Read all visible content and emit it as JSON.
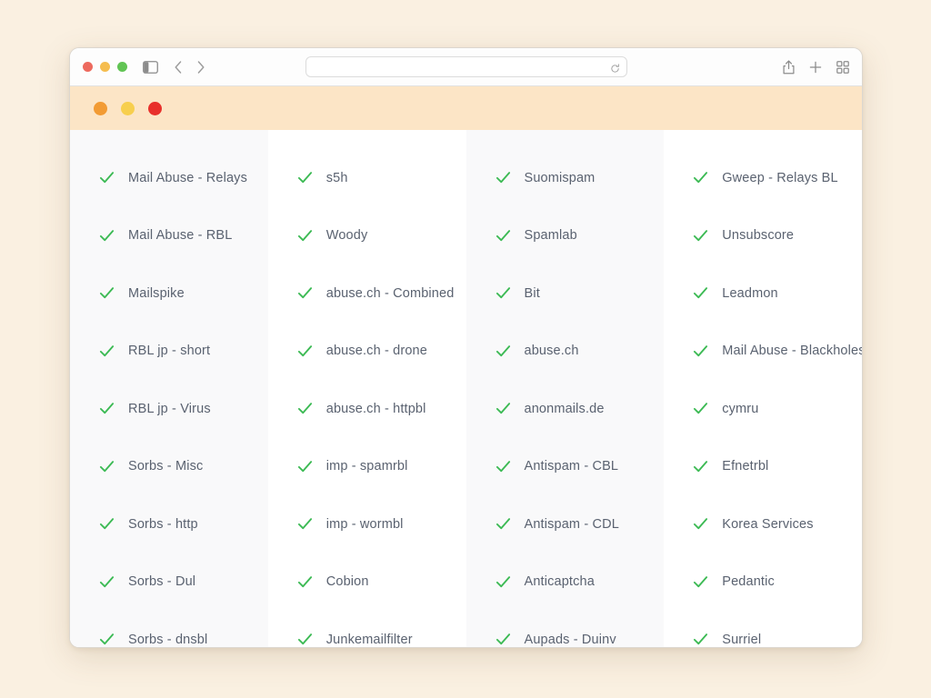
{
  "browser": {
    "traffic_lights": [
      {
        "name": "close",
        "color": "#ed6a5e"
      },
      {
        "name": "minimize",
        "color": "#f5bd4f"
      },
      {
        "name": "zoom",
        "color": "#61c454"
      }
    ],
    "sidebar_toggle_icon": "sidebar-toggle-icon",
    "back_icon": "chevron-left-icon",
    "forward_icon": "chevron-right-icon",
    "address": {
      "value": "",
      "placeholder": "",
      "reload_icon": "reload-icon"
    },
    "share_icon": "share-icon",
    "new_tab_icon": "plus-icon",
    "tab_overview_icon": "tab-overview-icon"
  },
  "page": {
    "header_band": {
      "background": "#fce5c6",
      "dots": [
        {
          "name": "orange-dot",
          "color": "#f29b34"
        },
        {
          "name": "yellow-dot",
          "color": "#f7cf4e"
        },
        {
          "name": "red-dot",
          "color": "#e8302b"
        }
      ]
    },
    "check_color": "#3cba54",
    "label_color": "#5a6270",
    "shaded_column_bg": "#f9f9fa",
    "columns": [
      {
        "shaded": true,
        "items": [
          {
            "status_icon": "check-icon",
            "label": "Mail Abuse - Relays"
          },
          {
            "status_icon": "check-icon",
            "label": "Mail Abuse - RBL"
          },
          {
            "status_icon": "check-icon",
            "label": "Mailspike"
          },
          {
            "status_icon": "check-icon",
            "label": "RBL jp - short"
          },
          {
            "status_icon": "check-icon",
            "label": "RBL jp - Virus"
          },
          {
            "status_icon": "check-icon",
            "label": "Sorbs - Misc"
          },
          {
            "status_icon": "check-icon",
            "label": "Sorbs - http"
          },
          {
            "status_icon": "check-icon",
            "label": "Sorbs - Dul"
          },
          {
            "status_icon": "check-icon",
            "label": "Sorbs - dnsbl"
          }
        ]
      },
      {
        "shaded": false,
        "items": [
          {
            "status_icon": "check-icon",
            "label": "s5h"
          },
          {
            "status_icon": "check-icon",
            "label": "Woody"
          },
          {
            "status_icon": "check-icon",
            "label": "abuse.ch - Combined"
          },
          {
            "status_icon": "check-icon",
            "label": "abuse.ch - drone"
          },
          {
            "status_icon": "check-icon",
            "label": "abuse.ch - httpbl"
          },
          {
            "status_icon": "check-icon",
            "label": "imp - spamrbl"
          },
          {
            "status_icon": "check-icon",
            "label": "imp - wormbl"
          },
          {
            "status_icon": "check-icon",
            "label": "Cobion"
          },
          {
            "status_icon": "check-icon",
            "label": "Junkemailfilter"
          }
        ]
      },
      {
        "shaded": true,
        "items": [
          {
            "status_icon": "check-icon",
            "label": "Suomispam"
          },
          {
            "status_icon": "check-icon",
            "label": "Spamlab"
          },
          {
            "status_icon": "check-icon",
            "label": "Bit"
          },
          {
            "status_icon": "check-icon",
            "label": "abuse.ch"
          },
          {
            "status_icon": "check-icon",
            "label": "anonmails.de"
          },
          {
            "status_icon": "check-icon",
            "label": "Antispam - CBL"
          },
          {
            "status_icon": "check-icon",
            "label": "Antispam - CDL"
          },
          {
            "status_icon": "check-icon",
            "label": "Anticaptcha"
          },
          {
            "status_icon": "check-icon",
            "label": "Aupads - Duinv"
          }
        ]
      },
      {
        "shaded": false,
        "items": [
          {
            "status_icon": "check-icon",
            "label": "Gweep - Relays BL"
          },
          {
            "status_icon": "check-icon",
            "label": "Unsubscore"
          },
          {
            "status_icon": "check-icon",
            "label": "Leadmon"
          },
          {
            "status_icon": "check-icon",
            "label": "Mail Abuse - Blackholes"
          },
          {
            "status_icon": "check-icon",
            "label": "cymru"
          },
          {
            "status_icon": "check-icon",
            "label": "Efnetrbl"
          },
          {
            "status_icon": "check-icon",
            "label": "Korea Services"
          },
          {
            "status_icon": "check-icon",
            "label": "Pedantic"
          },
          {
            "status_icon": "check-icon",
            "label": "Surriel"
          }
        ]
      }
    ]
  }
}
